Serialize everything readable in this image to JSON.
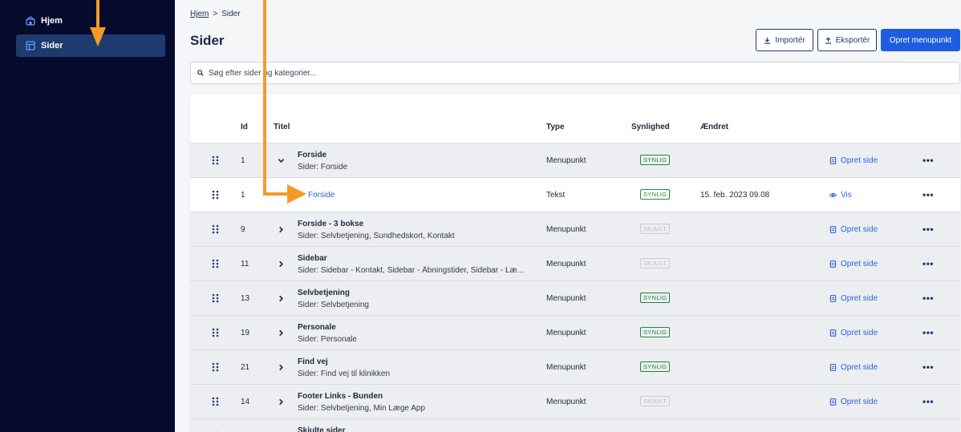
{
  "nav": [
    {
      "label": "Hjem",
      "icon": "home-icon"
    },
    {
      "label": "Sider",
      "icon": "pages-icon"
    }
  ],
  "breadcrumb": {
    "home": "Hjem",
    "separator": ">",
    "current": "Sider"
  },
  "page_title": "Sider",
  "toolbar": {
    "import_label": "Importér",
    "export_label": "Eksportér",
    "create_label": "Opret menupunkt"
  },
  "search": {
    "placeholder": "Søg efter sider og kategorier..."
  },
  "table": {
    "columns": [
      "Id",
      "Titel",
      "Type",
      "Synlighed",
      "Ændret"
    ],
    "rows": [
      {
        "id": "1",
        "title": "Forside",
        "subtitle": "Sider: Forside",
        "type": "Menupunkt",
        "visibility": "SYNLIG",
        "changed": "",
        "action": "Opret side",
        "expanded": true,
        "child": false
      },
      {
        "id": "1",
        "title": "Forside",
        "subtitle": "",
        "type": "Tekst",
        "visibility": "SYNLIG",
        "changed": "15. feb. 2023 09.08",
        "action": "Vis",
        "expanded": false,
        "child": true
      },
      {
        "id": "9",
        "title": "Forside - 3 bokse",
        "subtitle": "Sider: Selvbetjening, Sundhedskort, Kontakt",
        "type": "Menupunkt",
        "visibility": "SKJULT",
        "changed": "",
        "action": "Opret side",
        "expanded": false,
        "child": false
      },
      {
        "id": "11",
        "title": "Sidebar",
        "subtitle": "Sider: Sidebar - Kontakt, Sidebar - Åbningstider, Sidebar - Læ...",
        "type": "Menupunkt",
        "visibility": "SKJULT",
        "changed": "",
        "action": "Opret side",
        "expanded": false,
        "child": false
      },
      {
        "id": "13",
        "title": "Selvbetjening",
        "subtitle": "Sider: Selvbetjening",
        "type": "Menupunkt",
        "visibility": "SYNLIG",
        "changed": "",
        "action": "Opret side",
        "expanded": false,
        "child": false
      },
      {
        "id": "19",
        "title": "Personale",
        "subtitle": "Sider: Personale",
        "type": "Menupunkt",
        "visibility": "SYNLIG",
        "changed": "",
        "action": "Opret side",
        "expanded": false,
        "child": false
      },
      {
        "id": "21",
        "title": "Find vej",
        "subtitle": "Sider: Find vej til klinikken",
        "type": "Menupunkt",
        "visibility": "SYNLIG",
        "changed": "",
        "action": "Opret side",
        "expanded": false,
        "child": false
      },
      {
        "id": "14",
        "title": "Footer Links - Bunden",
        "subtitle": "Sider: Selvbetjening, Min Læge App",
        "type": "Menupunkt",
        "visibility": "SKJULT",
        "changed": "",
        "action": "Opret side",
        "expanded": false,
        "child": false
      },
      {
        "id": "",
        "title": "Skjulte sider",
        "subtitle": "",
        "type": "",
        "visibility": "",
        "changed": "",
        "action": "",
        "expanded": false,
        "child": false
      }
    ]
  },
  "colors": {
    "sidebar_bg": "#060b2e",
    "nav_active": "#1f3a6e",
    "primary": "#1f5ce0",
    "link": "#2f62d8",
    "visible_badge": "#1f8a3a",
    "hidden_badge": "#b9bec6",
    "annotation_arrow": "#f59b25"
  }
}
